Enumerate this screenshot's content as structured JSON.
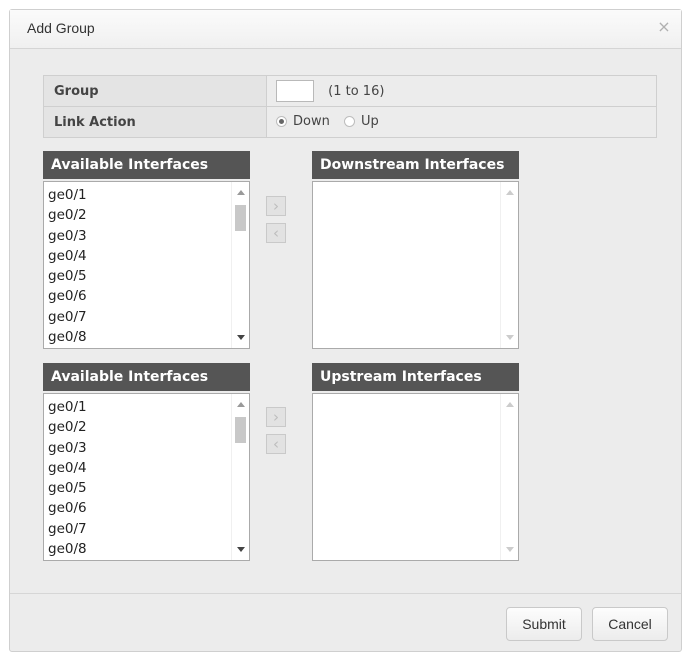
{
  "dialog": {
    "title": "Add Group",
    "close_glyph": "×"
  },
  "settings": {
    "group_label": "Group",
    "group_value": "",
    "group_hint": "(1 to 16)",
    "link_action_label": "Link Action",
    "options": [
      {
        "label": "Down",
        "checked": true
      },
      {
        "label": "Up",
        "checked": false
      }
    ]
  },
  "downstream_section": {
    "available_header": "Available Interfaces",
    "available_items": [
      "ge0/1",
      "ge0/2",
      "ge0/3",
      "ge0/4",
      "ge0/5",
      "ge0/6",
      "ge0/7",
      "ge0/8"
    ],
    "selected_header": "Downstream Interfaces",
    "selected_items": []
  },
  "upstream_section": {
    "available_header": "Available Interfaces",
    "available_items": [
      "ge0/1",
      "ge0/2",
      "ge0/3",
      "ge0/4",
      "ge0/5",
      "ge0/6",
      "ge0/7",
      "ge0/8"
    ],
    "selected_header": "Upstream Interfaces",
    "selected_items": []
  },
  "buttons": {
    "add_glyph": "›",
    "remove_glyph": "‹",
    "submit": "Submit",
    "cancel": "Cancel"
  },
  "icons": {
    "close": "close-icon",
    "add": "chevron-right-icon",
    "remove": "chevron-left-icon"
  }
}
